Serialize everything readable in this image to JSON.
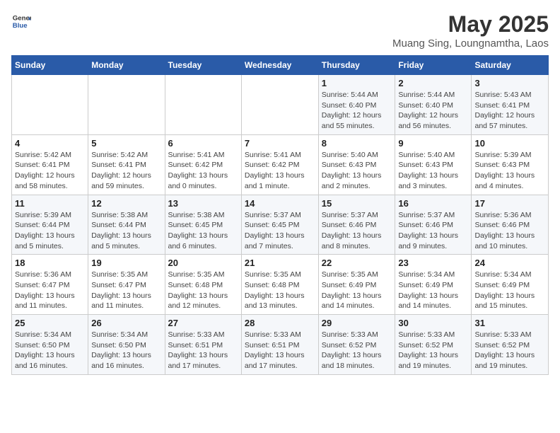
{
  "header": {
    "logo_general": "General",
    "logo_blue": "Blue",
    "title": "May 2025",
    "subtitle": "Muang Sing, Loungnamtha, Laos"
  },
  "weekdays": [
    "Sunday",
    "Monday",
    "Tuesday",
    "Wednesday",
    "Thursday",
    "Friday",
    "Saturday"
  ],
  "weeks": [
    [
      {
        "day": "",
        "info": ""
      },
      {
        "day": "",
        "info": ""
      },
      {
        "day": "",
        "info": ""
      },
      {
        "day": "",
        "info": ""
      },
      {
        "day": "1",
        "info": "Sunrise: 5:44 AM\nSunset: 6:40 PM\nDaylight: 12 hours\nand 55 minutes."
      },
      {
        "day": "2",
        "info": "Sunrise: 5:44 AM\nSunset: 6:40 PM\nDaylight: 12 hours\nand 56 minutes."
      },
      {
        "day": "3",
        "info": "Sunrise: 5:43 AM\nSunset: 6:41 PM\nDaylight: 12 hours\nand 57 minutes."
      }
    ],
    [
      {
        "day": "4",
        "info": "Sunrise: 5:42 AM\nSunset: 6:41 PM\nDaylight: 12 hours\nand 58 minutes."
      },
      {
        "day": "5",
        "info": "Sunrise: 5:42 AM\nSunset: 6:41 PM\nDaylight: 12 hours\nand 59 minutes."
      },
      {
        "day": "6",
        "info": "Sunrise: 5:41 AM\nSunset: 6:42 PM\nDaylight: 13 hours\nand 0 minutes."
      },
      {
        "day": "7",
        "info": "Sunrise: 5:41 AM\nSunset: 6:42 PM\nDaylight: 13 hours\nand 1 minute."
      },
      {
        "day": "8",
        "info": "Sunrise: 5:40 AM\nSunset: 6:43 PM\nDaylight: 13 hours\nand 2 minutes."
      },
      {
        "day": "9",
        "info": "Sunrise: 5:40 AM\nSunset: 6:43 PM\nDaylight: 13 hours\nand 3 minutes."
      },
      {
        "day": "10",
        "info": "Sunrise: 5:39 AM\nSunset: 6:43 PM\nDaylight: 13 hours\nand 4 minutes."
      }
    ],
    [
      {
        "day": "11",
        "info": "Sunrise: 5:39 AM\nSunset: 6:44 PM\nDaylight: 13 hours\nand 5 minutes."
      },
      {
        "day": "12",
        "info": "Sunrise: 5:38 AM\nSunset: 6:44 PM\nDaylight: 13 hours\nand 5 minutes."
      },
      {
        "day": "13",
        "info": "Sunrise: 5:38 AM\nSunset: 6:45 PM\nDaylight: 13 hours\nand 6 minutes."
      },
      {
        "day": "14",
        "info": "Sunrise: 5:37 AM\nSunset: 6:45 PM\nDaylight: 13 hours\nand 7 minutes."
      },
      {
        "day": "15",
        "info": "Sunrise: 5:37 AM\nSunset: 6:46 PM\nDaylight: 13 hours\nand 8 minutes."
      },
      {
        "day": "16",
        "info": "Sunrise: 5:37 AM\nSunset: 6:46 PM\nDaylight: 13 hours\nand 9 minutes."
      },
      {
        "day": "17",
        "info": "Sunrise: 5:36 AM\nSunset: 6:46 PM\nDaylight: 13 hours\nand 10 minutes."
      }
    ],
    [
      {
        "day": "18",
        "info": "Sunrise: 5:36 AM\nSunset: 6:47 PM\nDaylight: 13 hours\nand 11 minutes."
      },
      {
        "day": "19",
        "info": "Sunrise: 5:35 AM\nSunset: 6:47 PM\nDaylight: 13 hours\nand 11 minutes."
      },
      {
        "day": "20",
        "info": "Sunrise: 5:35 AM\nSunset: 6:48 PM\nDaylight: 13 hours\nand 12 minutes."
      },
      {
        "day": "21",
        "info": "Sunrise: 5:35 AM\nSunset: 6:48 PM\nDaylight: 13 hours\nand 13 minutes."
      },
      {
        "day": "22",
        "info": "Sunrise: 5:35 AM\nSunset: 6:49 PM\nDaylight: 13 hours\nand 14 minutes."
      },
      {
        "day": "23",
        "info": "Sunrise: 5:34 AM\nSunset: 6:49 PM\nDaylight: 13 hours\nand 14 minutes."
      },
      {
        "day": "24",
        "info": "Sunrise: 5:34 AM\nSunset: 6:49 PM\nDaylight: 13 hours\nand 15 minutes."
      }
    ],
    [
      {
        "day": "25",
        "info": "Sunrise: 5:34 AM\nSunset: 6:50 PM\nDaylight: 13 hours\nand 16 minutes."
      },
      {
        "day": "26",
        "info": "Sunrise: 5:34 AM\nSunset: 6:50 PM\nDaylight: 13 hours\nand 16 minutes."
      },
      {
        "day": "27",
        "info": "Sunrise: 5:33 AM\nSunset: 6:51 PM\nDaylight: 13 hours\nand 17 minutes."
      },
      {
        "day": "28",
        "info": "Sunrise: 5:33 AM\nSunset: 6:51 PM\nDaylight: 13 hours\nand 17 minutes."
      },
      {
        "day": "29",
        "info": "Sunrise: 5:33 AM\nSunset: 6:52 PM\nDaylight: 13 hours\nand 18 minutes."
      },
      {
        "day": "30",
        "info": "Sunrise: 5:33 AM\nSunset: 6:52 PM\nDaylight: 13 hours\nand 19 minutes."
      },
      {
        "day": "31",
        "info": "Sunrise: 5:33 AM\nSunset: 6:52 PM\nDaylight: 13 hours\nand 19 minutes."
      }
    ]
  ]
}
